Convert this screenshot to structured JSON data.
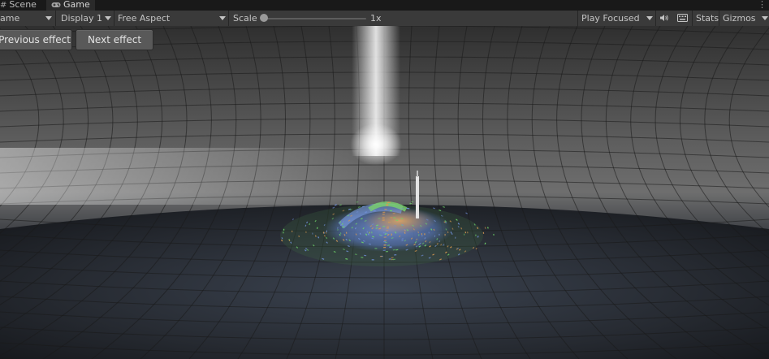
{
  "tabs": [
    {
      "label": "Scene",
      "icon": "hash-icon"
    },
    {
      "label": "Game",
      "icon": "gamepad-icon"
    }
  ],
  "toolbar": {
    "game_mode": "ame",
    "display": "Display 1",
    "aspect": "Free Aspect",
    "scale_label": "Scale",
    "scale_value": "1x",
    "scale_fraction": 0.0,
    "play_mode": "Play Focused",
    "stats": "Stats",
    "gizmos": "Gizmos"
  },
  "overlay": {
    "previous_label": "Previous effect",
    "next_label": "Next effect"
  },
  "colors": {
    "accent": "#3a79bb",
    "toolbar_bg": "#3a3a3a",
    "particle_blue": "#6f8fd6",
    "particle_green": "#6fd36a",
    "particle_orange": "#d89a52"
  }
}
